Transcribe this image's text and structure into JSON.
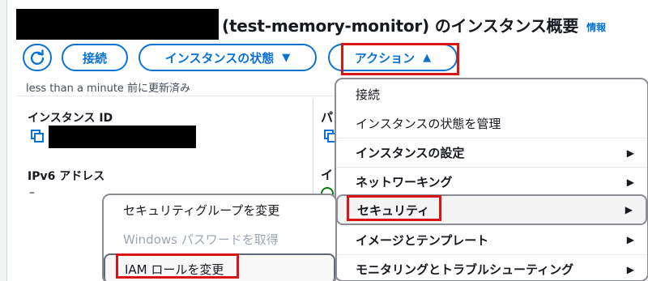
{
  "header": {
    "title_suffix": "(test-memory-monitor) のインスタンス概要",
    "info_link": "情報"
  },
  "buttons": {
    "connect": "接続",
    "instance_state": "インスタンスの状態",
    "actions": "アクション"
  },
  "updated_text": "less than a minute 前に更新済み",
  "fields": {
    "instance_id_label": "インスタンス ID",
    "ipv6_label": "IPv6 アドレス",
    "ipv6_value": "–",
    "clipped_label_1": "パ",
    "clipped_label_2": "イ"
  },
  "actions_menu": {
    "items": [
      {
        "label": "接続"
      },
      {
        "label": "インスタンスの状態を管理"
      },
      {
        "label": "インスタンスの設定"
      },
      {
        "label": "ネットワーキング"
      },
      {
        "label": "セキュリティ"
      },
      {
        "label": "イメージとテンプレート"
      },
      {
        "label": "モニタリングとトラブルシューティング"
      }
    ]
  },
  "security_submenu": {
    "items": [
      {
        "label": "セキュリティグループを変更"
      },
      {
        "label": "Windows パスワードを取得"
      },
      {
        "label": "IAM ロールを変更"
      }
    ]
  },
  "colors": {
    "accent": "#0972d3",
    "highlight": "#d91515",
    "disabled": "#9ba7b6"
  },
  "icons": [
    "refresh-icon",
    "caret-down-icon",
    "caret-up-icon",
    "copy-icon",
    "chevron-right-icon",
    "status-check-icon"
  ]
}
